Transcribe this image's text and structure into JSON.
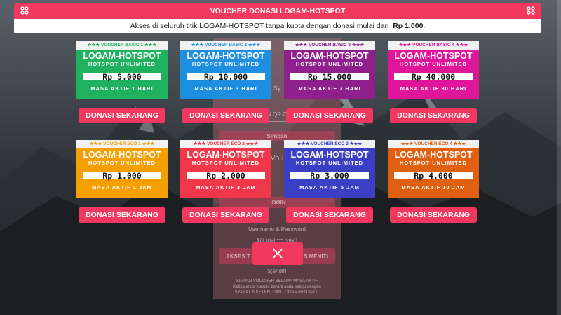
{
  "header": {
    "title": "VOUCHER DONASI LOGAM-HOTSPOT",
    "subtitle_text": "Akses di seluruh titik LOGAM-HOTSPOT tanpa kuota dengan donasi mulai dari",
    "subtitle_price": "Rp 1.000",
    "subtitle_end": "."
  },
  "icons": {
    "left": "grid-icon",
    "right": "grid-icon",
    "close": "close-icon"
  },
  "colors": {
    "accent": "#f2385f"
  },
  "vouchers": [
    {
      "header": "★★★ VOUCHER BASIC 1 ★★★",
      "brand": "LOGAM-HOTSPOT",
      "tag": "HOTSPOT UNLIMITED",
      "price": "Rp 5.000",
      "duration": "MASA AKTIF 1 HARI",
      "color": "#1fb15e",
      "star_color": "#1fb15e",
      "button": "DONASI SEKARANG"
    },
    {
      "header": "★★★ VOUCHER BASIC 2 ★★★",
      "brand": "LOGAM-HOTSPOT",
      "tag": "HOTSPOT UNLIMITED",
      "price": "Rp 10.000",
      "duration": "MASA AKTIF 3 HARI",
      "color": "#1e8fe0",
      "star_color": "#1e8fe0",
      "button": "DONASI SEKARANG"
    },
    {
      "header": "★★★ VOUCHER BASIC 3 ★★★",
      "brand": "LOGAM-HOTSPOT",
      "tag": "HOTSPOT UNLIMITED",
      "price": "Rp 15.000",
      "duration": "MASA AKTIF 7 HARI",
      "color": "#8e1f8c",
      "star_color": "#8e1f8c",
      "button": "DONASI SEKARANG"
    },
    {
      "header": "★★★ VOUCHER BASIC 4 ★★★",
      "brand": "LOGAM-HOTSPOT",
      "tag": "HOTSPOT UNLIMITED",
      "price": "Rp 40.000",
      "duration": "MASA AKTIF 30 HARI",
      "color": "#e0169a",
      "star_color": "#e0169a",
      "button": "DONASI SEKARANG"
    },
    {
      "header": "★★★ VOUCHER ECO 1 ★★★",
      "brand": "LOGAM-HOTSPOT",
      "tag": "HOTSPOT UNLIMITED",
      "price": "Rp 1.000",
      "duration": "MASA AKTIF 1 JAM",
      "color": "#f5a000",
      "star_color": "#f5a000",
      "button": "DONASI SEKARANG"
    },
    {
      "header": "★★★ VOUCHER ECO 2 ★★★",
      "brand": "LOGAM-HOTSPOT",
      "tag": "HOTSPOT UNLIMITED",
      "price": "Rp 2.000",
      "duration": "MASA AKTIF 3 JAM",
      "color": "#f0384a",
      "star_color": "#f0384a",
      "button": "DONASI SEKARANG"
    },
    {
      "header": "★★★ VOUCHER ECO 3 ★★★",
      "brand": "LOGAM-HOTSPOT",
      "tag": "HOTSPOT UNLIMITED",
      "price": "Rp 3.000",
      "duration": "MASA AKTIF 5 JAM",
      "color": "#3b3fc4",
      "star_color": "#3b3fc4",
      "button": "DONASI SEKARANG"
    },
    {
      "header": "★★★ VOUCHER ECO 4 ★★★",
      "brand": "LOGAM-HOTSPOT",
      "tag": "HOTSPOT UNLIMITED",
      "price": "Rp 4.000",
      "duration": "MASA AKTIF 10 JAM",
      "color": "#e0600f",
      "star_color": "#e0600f",
      "button": "DONASI SEKARANG"
    }
  ],
  "background_form": {
    "line1": "N QR C",
    "line2": "Simpan",
    "line3": "Vou",
    "line4": "LOGIN",
    "line5": "Username & Password",
    "line6": "$(if trial == 'yes')",
    "line7_left": "AKSES T",
    "line7_right": "5 MENIT)",
    "line8": "$(endif)",
    "line9": "SIMPAN VOUCHER SELAMA MASA AKTIF",
    "line10": "Ketika anda masuk, berarti anda setuju dengan",
    "line11": "SYARAT & KETENTUAN LOGAM-HOTSPOT",
    "line12": "Sy"
  }
}
